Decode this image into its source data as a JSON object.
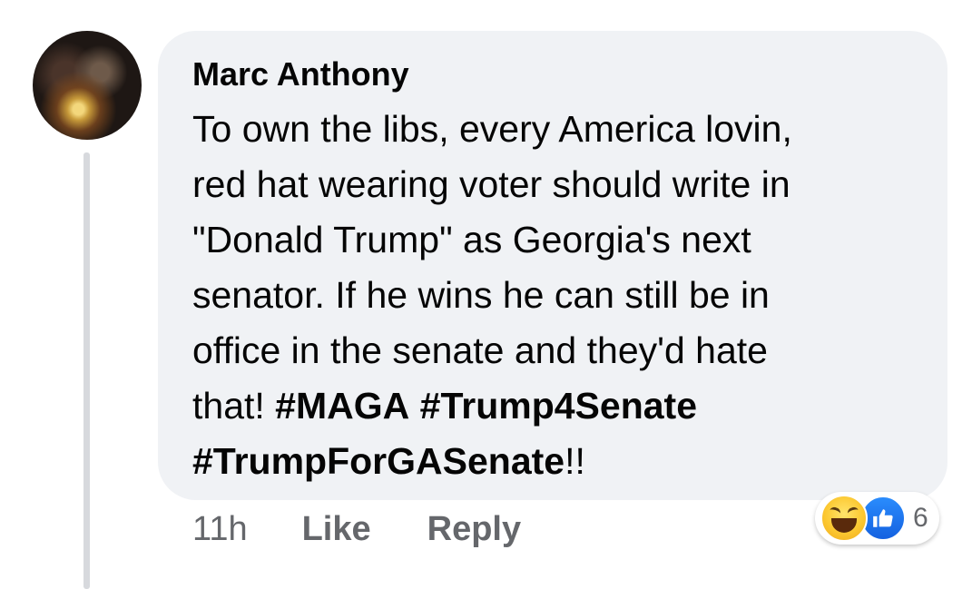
{
  "comment": {
    "author": "Marc Anthony",
    "text_lines": [
      {
        "plain": "To own the libs, every America lovin,"
      },
      {
        "plain": "red hat wearing voter should write in"
      },
      {
        "plain": "\"Donald Trump\" as Georgia's next"
      },
      {
        "plain": "senator. If he wins he can still be in"
      },
      {
        "plain": "office in the senate and they'd hate"
      }
    ],
    "line6_prefix": "that! ",
    "hashtag_1": "#MAGA",
    "hashtag_2": "#Trump4Senate",
    "hashtag_3": "#TrumpForGASenate",
    "line7_suffix": "!!"
  },
  "actions": {
    "time": "11h",
    "like_label": "Like",
    "reply_label": "Reply"
  },
  "reactions": {
    "icons": [
      "haha-icon",
      "like-icon"
    ],
    "count": "6"
  },
  "colors": {
    "bubble_bg": "#f0f2f5",
    "text": "#050505",
    "secondary_text": "#65676b",
    "like_blue": "#1877f2",
    "thread_line": "#d7d9dd"
  }
}
